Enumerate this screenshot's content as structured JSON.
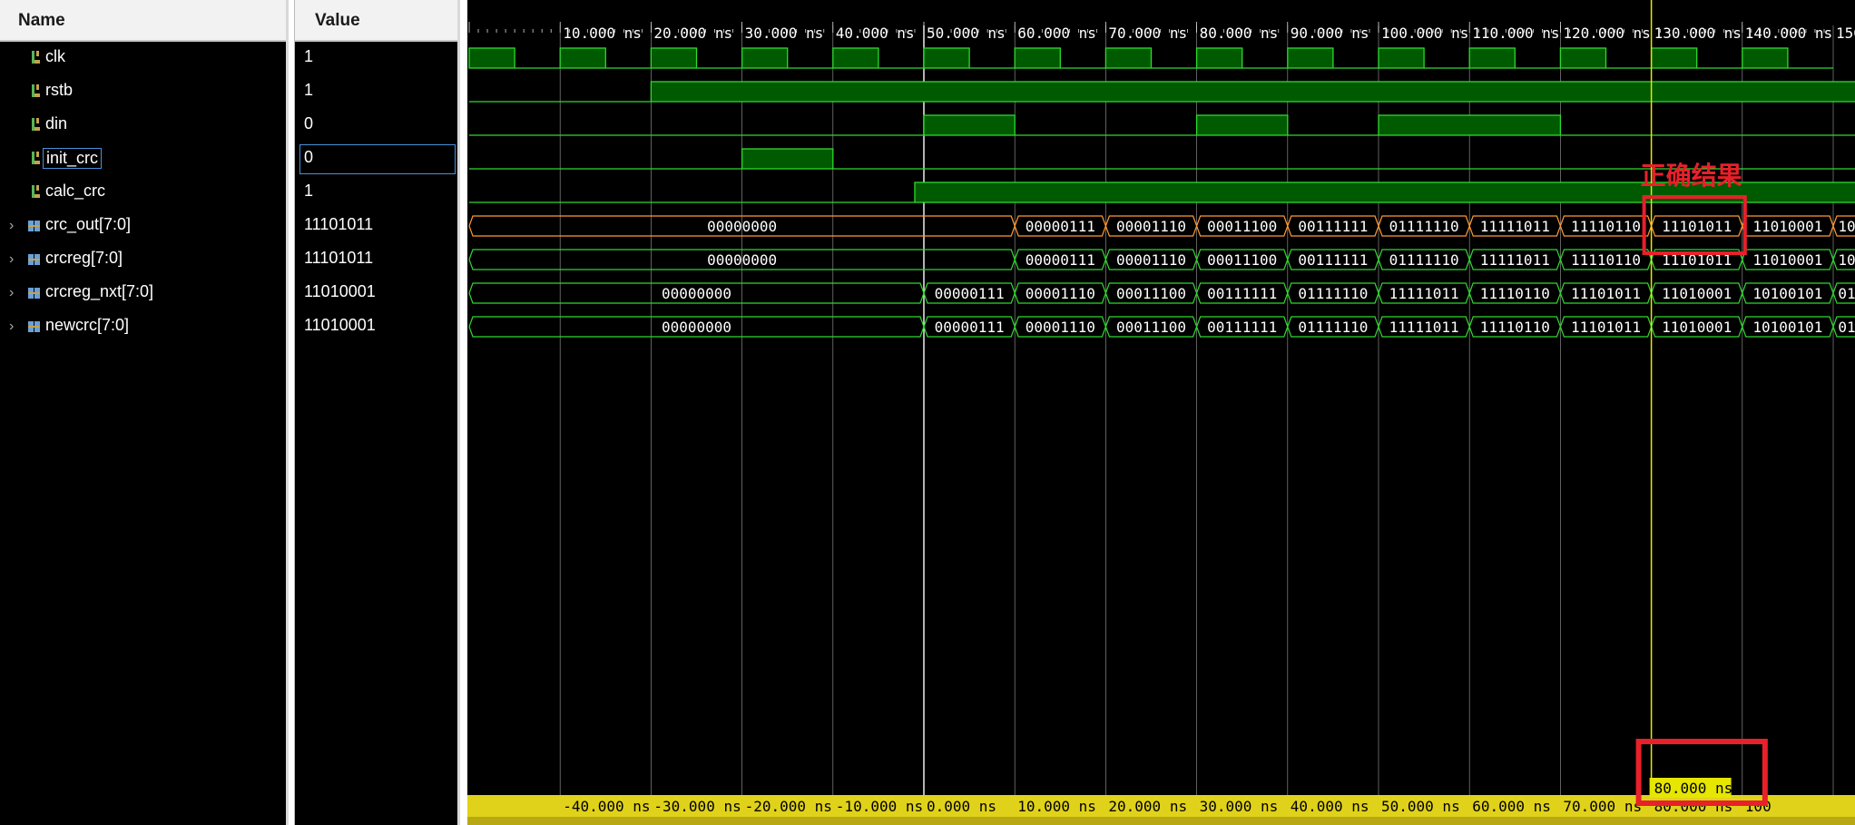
{
  "headers": {
    "name": "Name",
    "value": "Value"
  },
  "signals": [
    {
      "name": "clk",
      "value": "1",
      "type": "bit",
      "expandable": false
    },
    {
      "name": "rstb",
      "value": "1",
      "type": "bit",
      "expandable": false
    },
    {
      "name": "din",
      "value": "0",
      "type": "bit",
      "expandable": false
    },
    {
      "name": "init_crc",
      "value": "0",
      "type": "bit",
      "expandable": false,
      "selected": true
    },
    {
      "name": "calc_crc",
      "value": "1",
      "type": "bit",
      "expandable": false
    },
    {
      "name": "crc_out[7:0]",
      "value": "11101011",
      "type": "bus",
      "expandable": true
    },
    {
      "name": "crcreg[7:0]",
      "value": "11101011",
      "type": "bus",
      "expandable": true
    },
    {
      "name": "crcreg_nxt[7:0]",
      "value": "11010001",
      "type": "bus",
      "expandable": true
    },
    {
      "name": "newcrc[7:0]",
      "value": "11010001",
      "type": "bus",
      "expandable": true
    }
  ],
  "top_ruler": [
    "10.000 ns",
    "20.000 ns",
    "30.000 ns",
    "40.000 ns",
    "50.000 ns",
    "60.000 ns",
    "70.000 ns",
    "80.000 ns",
    "90.000 ns",
    "100.000 ns",
    "110.000 ns",
    "120.000 ns",
    "130.000 ns",
    "140.000 ns",
    "150"
  ],
  "bottom_ruler": [
    "-40.000 ns",
    "-30.000 ns",
    "-20.000 ns",
    "-10.000 ns",
    "0.000 ns",
    "10.000 ns",
    "20.000 ns",
    "30.000 ns",
    "40.000 ns",
    "50.000 ns",
    "60.000 ns",
    "70.000 ns",
    "80.000 ns",
    "100"
  ],
  "cursor_readout": "80.000 ns",
  "annotation_label": "正确结果",
  "bus_segments": {
    "crc_out": [
      "00000000",
      "00000111",
      "00001110",
      "00011100",
      "00111111",
      "01111110",
      "11111011",
      "11110110",
      "11101011",
      "11010001",
      "10"
    ],
    "crcreg": [
      "00000000",
      "00000111",
      "00001110",
      "00011100",
      "00111111",
      "01111110",
      "11111011",
      "11110110",
      "11101011",
      "11010001",
      "10"
    ],
    "crcreg_nxt": [
      "00000000",
      "00000111",
      "00001110",
      "00011100",
      "00111111",
      "01111110",
      "11111011",
      "11110110",
      "11101011",
      "11010001",
      "10100101",
      "01"
    ],
    "newcrc": [
      "00000000",
      "00000111",
      "00001110",
      "00011100",
      "00111111",
      "01111110",
      "11111011",
      "11110110",
      "11101011",
      "11010001",
      "10100101",
      "01"
    ]
  },
  "colors": {
    "wave_green": "#2fd82f",
    "wave_fill": "#005a00",
    "crc_out_bus": "#ff9933",
    "cursor": "#e6e600",
    "ruler_bottom_bg": "#e0d21a",
    "annotation": "#e8202a"
  }
}
